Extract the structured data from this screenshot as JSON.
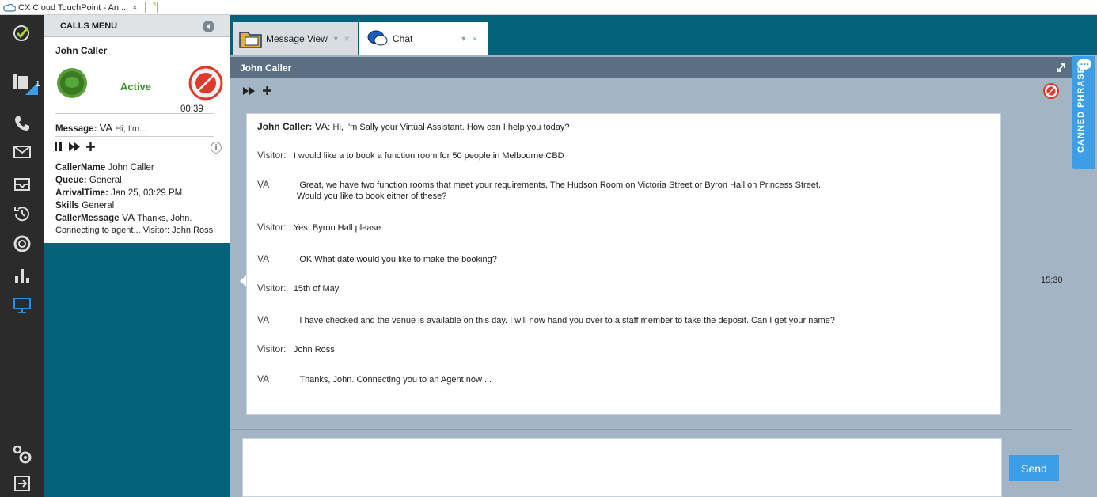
{
  "browser_tab": {
    "title": "CX Cloud TouchPoint - An...",
    "close": "×"
  },
  "rail": {
    "badge": "1"
  },
  "calls_menu": {
    "title": "CALLS MENU",
    "caller_name": "John Caller",
    "status": "Active",
    "timer": "00:39",
    "message_label": "Message:",
    "message_va": "VA",
    "message_text": "Hi, I'm...",
    "info_glyph": "ⓘ",
    "details": {
      "caller_name_label": "CallerName",
      "caller_name_value": "John Caller",
      "queue_label": "Queue:",
      "queue_value": "General",
      "arrival_label": "ArrivalTime:",
      "arrival_value": "Jan 25, 03:29 PM",
      "skills_label": "Skills",
      "skills_value": "General",
      "caller_message_label": "CallerMessage",
      "caller_message_va": "VA",
      "caller_message_text": "Thanks, John.",
      "caller_message_line2": "Connecting to agent... Visitor: John Ross"
    }
  },
  "tabs": [
    {
      "label": "Message View",
      "arrow": "▼",
      "close": "×"
    },
    {
      "label": "Chat",
      "arrow": "▼",
      "close": "×"
    }
  ],
  "chat": {
    "header_name": "John Caller",
    "transcript": [
      {
        "speaker": "John Caller:",
        "va": "VA",
        "text": "Hi, I'm Sally your Virtual Assistant. How can I help you today?"
      },
      {
        "speaker": "Visitor:",
        "text": "I would like a to book a function room for 50 people in Melbourne CBD"
      },
      {
        "speaker": "VA",
        "text": "Great, we have two function rooms that meet your requirements, The Hudson Room on Victoria Street or Byron Hall on Princess Street.",
        "text2": "Would you like to book either of these?"
      },
      {
        "speaker": "Visitor:",
        "text": "Yes, Byron Hall please"
      },
      {
        "speaker": "VA",
        "text": "OK  What date would you like to make the booking?"
      },
      {
        "speaker": "Visitor:",
        "text": "15th of May"
      },
      {
        "speaker": "VA",
        "text": "I have checked and the venue is available on this day.  I will now hand you over to a staff member to take the deposit.  Can I get your name?"
      },
      {
        "speaker": "Visitor:",
        "text": "John Ross"
      },
      {
        "speaker": "VA",
        "text": "Thanks, John. Connecting you to an Agent now ..."
      }
    ],
    "timestamp": "15:30",
    "input_value": "",
    "send_label": "Send"
  },
  "canned_phrases": {
    "label": "CANNED PHRASES"
  },
  "colors": {
    "teal": "#05627a",
    "rail": "#2b2b2b",
    "accent": "#3d9ee8",
    "active_green": "#3a8f2a",
    "end_red": "#e0392a"
  }
}
